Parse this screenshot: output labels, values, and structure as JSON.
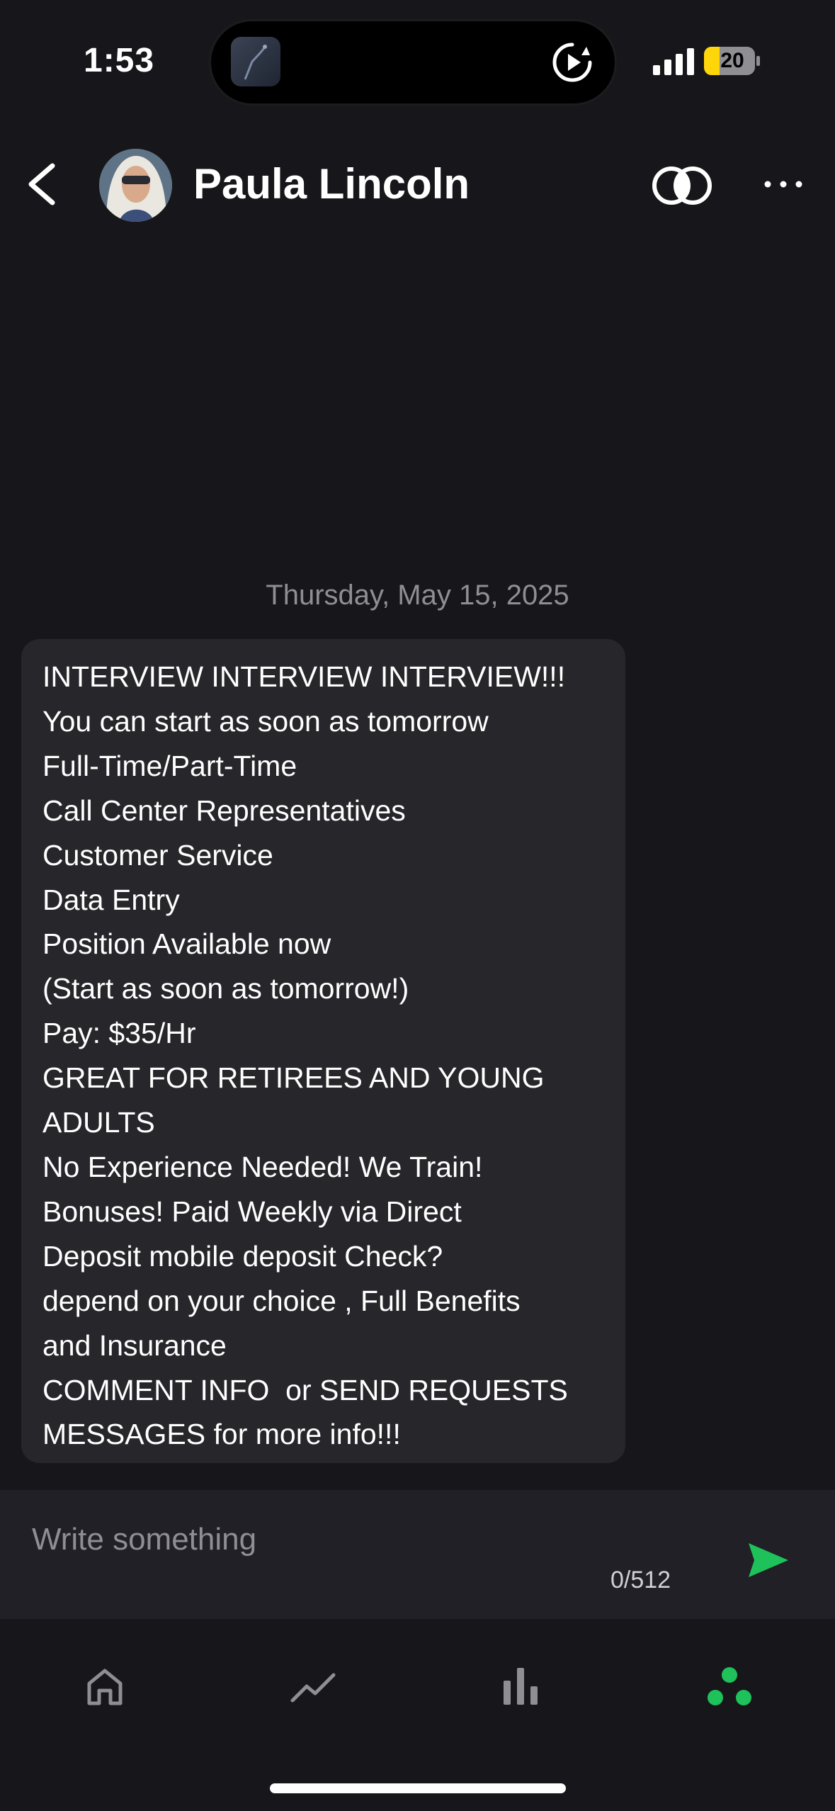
{
  "status_bar": {
    "time": "1:53",
    "battery_level": "20",
    "battery_color": "#ffd60a"
  },
  "header": {
    "contact_name": "Paula Lincoln",
    "back_icon": "chevron-left-icon",
    "compare_icon": "overlapping-circles-icon",
    "more_icon": "ellipsis-icon"
  },
  "conversation": {
    "date_separator": "Thursday, May 15, 2025",
    "messages": [
      {
        "lines": [
          "INTERVIEW INTERVIEW INTERVIEW!!!",
          "You can start as soon as tomorrow",
          "Full-Time/Part-Time",
          "Call Center Representatives",
          "Customer Service",
          "Data Entry",
          "Position Available now",
          "(Start as soon as tomorrow!)",
          "Pay: $35/Hr",
          "GREAT FOR RETIREES AND YOUNG",
          "ADULTS",
          "No Experience Needed! We Train!",
          "Bonuses! Paid Weekly via Direct",
          "Deposit mobile deposit Check?",
          "depend on your choice , Full Benefits",
          "and Insurance",
          "COMMENT INFO  or SEND REQUESTS",
          "MESSAGES for more info!!!"
        ]
      }
    ]
  },
  "composer": {
    "placeholder": "Write something",
    "value": "",
    "char_count": "0/512",
    "send_icon": "send-icon",
    "accent_color": "#1fc15a"
  },
  "bottom_nav": {
    "items": [
      {
        "icon": "home-icon",
        "active": false
      },
      {
        "icon": "trend-line-icon",
        "active": false
      },
      {
        "icon": "bar-chart-icon",
        "active": false
      },
      {
        "icon": "community-dots-icon",
        "active": true
      }
    ]
  }
}
